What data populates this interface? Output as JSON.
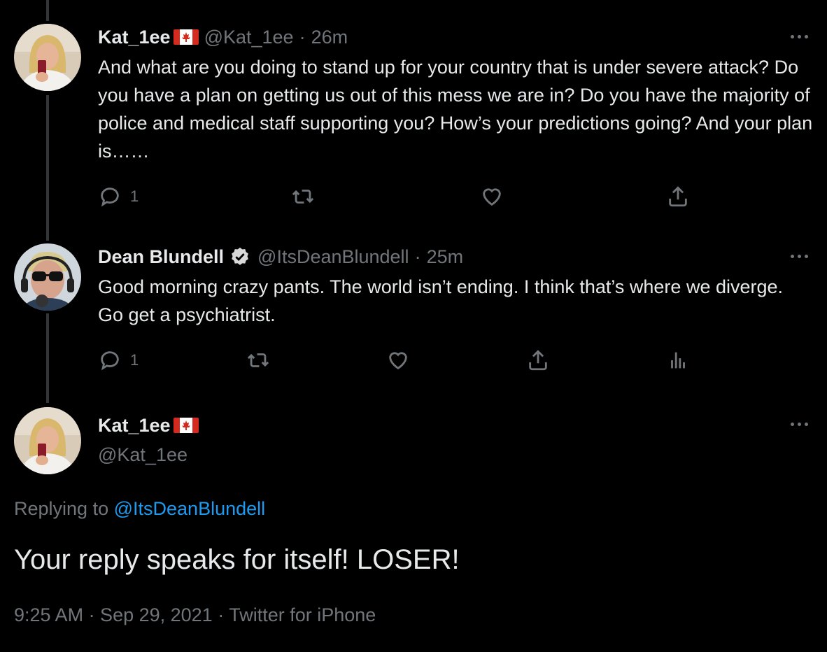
{
  "tweets": [
    {
      "name": "Kat_1ee",
      "handle": "@Kat_1ee",
      "sep": "·",
      "time": "26m",
      "text": "And what are you doing to stand up for your country that is under severe attack? Do you have a plan on getting us out of this mess we are in? Do you have the majority of police and medical staff supporting you?  How’s your predictions going? And your plan is……",
      "reply_count": "1",
      "icons": [
        "reply-icon",
        "retweet-icon",
        "like-icon",
        "share-icon"
      ]
    },
    {
      "name": "Dean Blundell",
      "handle": "@ItsDeanBlundell",
      "sep": "·",
      "time": "25m",
      "text": "Good morning crazy pants.  The world isn’t ending. I think that’s where we diverge.  Go get a psychiatrist.",
      "reply_count": "1",
      "icons": [
        "reply-icon",
        "retweet-icon",
        "like-icon",
        "share-icon",
        "analytics-icon"
      ]
    }
  ],
  "main_tweet": {
    "name": "Kat_1ee",
    "handle": "@Kat_1ee",
    "replying_prefix": "Replying to",
    "replying_to": "@ItsDeanBlundell",
    "text": "Your reply speaks for itself! LOSER!",
    "timestamp": "9:25 AM · Sep 29, 2021 · Twitter for iPhone"
  },
  "colors": {
    "background": "#000000",
    "text": "#e7e9ea",
    "secondary": "#71767b",
    "link": "#1d9bf0",
    "verified": "#d9d9d9",
    "flag_red": "#d52b1e"
  }
}
